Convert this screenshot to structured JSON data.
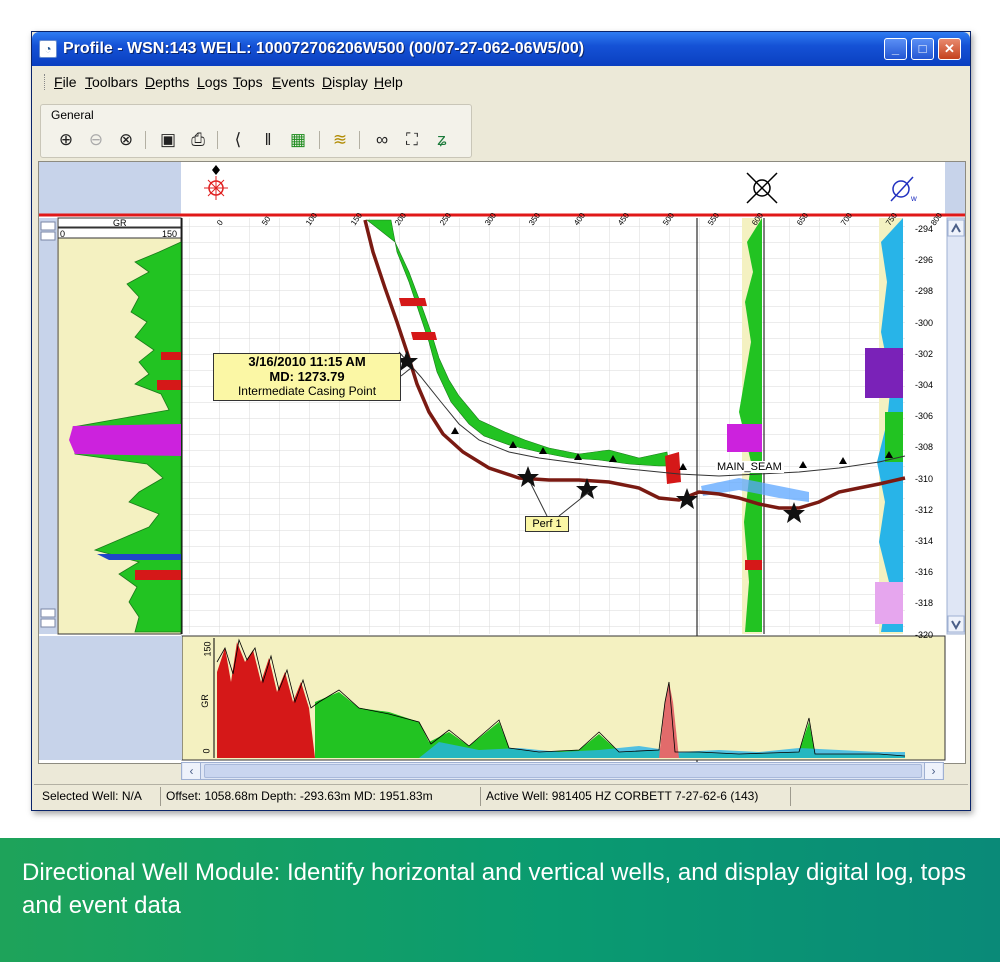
{
  "window": {
    "title": "Profile - WSN:143 WELL: 100072706206W500 (00/07-27-062-06W5/00)",
    "buttons": {
      "minimize": "_",
      "maximize": "□",
      "close": "✕"
    }
  },
  "menu": [
    "File",
    "Toolbars",
    "Depths",
    "Logs",
    "Tops",
    "Events",
    "Display",
    "Help"
  ],
  "toolbar": {
    "label": "General",
    "icons": [
      {
        "name": "zoom-in-icon",
        "glyph": "⊕"
      },
      {
        "name": "zoom-out-icon",
        "glyph": "⊖"
      },
      {
        "name": "zoom-reset-icon",
        "glyph": "⊗"
      },
      {
        "name": "image-icon",
        "glyph": "▣"
      },
      {
        "name": "export-icon",
        "glyph": "⎙"
      },
      {
        "name": "track-left-icon",
        "glyph": "⟨"
      },
      {
        "name": "tracks-icon",
        "glyph": "‖"
      },
      {
        "name": "track-grid-icon",
        "glyph": "▦"
      },
      {
        "name": "layers-icon",
        "glyph": "≋"
      },
      {
        "name": "glasses-icon",
        "glyph": "∞"
      },
      {
        "name": "camera-icon",
        "glyph": "⛶"
      },
      {
        "name": "well-path-icon",
        "glyph": "ʑ"
      }
    ]
  },
  "plot": {
    "gr_track_label": "GR",
    "gr_scale_min": "0",
    "gr_scale_max": "150",
    "top_axis_ticks": [
      "0",
      "50",
      "100",
      "150",
      "200",
      "250",
      "300",
      "350",
      "400",
      "450",
      "500",
      "550",
      "600",
      "650",
      "700",
      "750",
      "800"
    ],
    "depth_ticks": [
      "-294",
      "-296",
      "-298",
      "-300",
      "-302",
      "-304",
      "-306",
      "-308",
      "-310",
      "-312",
      "-314",
      "-316",
      "-318",
      "-320"
    ],
    "annotation": {
      "date": "3/16/2010 11:15 AM",
      "md": "MD: 1273.79",
      "label": "Intermediate Casing Point"
    },
    "perf_label": "Perf 1",
    "seam_label": "MAIN_SEAM",
    "bottom_gr_label": "GR",
    "bottom_gr_max": "150",
    "bottom_gr_min": "0"
  },
  "status": {
    "selected_well": "Selected Well: N/A",
    "position": "Offset: 1058.68m  Depth: -293.63m  MD: 1951.83m",
    "active_well": "Active Well: 981405 HZ CORBETT 7-27-62-6 (143)"
  },
  "caption": "Directional Well Module: Identify horizontal and vertical wells, and display digital log, tops and event data",
  "colors": {
    "gr_fill_high": "#20c020",
    "gr_fill_low": "#f4f1c1",
    "trajectory": "#7a1a12",
    "banner": "#0a9b70"
  }
}
